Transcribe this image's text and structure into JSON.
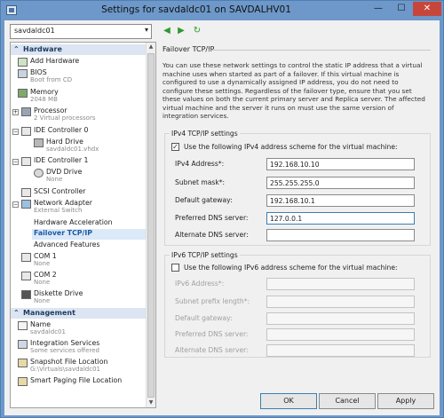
{
  "window": {
    "title": "Settings for savdaldc01 on SAVDALHV01",
    "minimize": "—",
    "maximize": "☐",
    "close": "✕"
  },
  "vm_select": {
    "value": "savdaldc01"
  },
  "nav": {
    "back": "◀",
    "forward": "▶",
    "refresh": "↻"
  },
  "sidebar": {
    "hardware_header": "Hardware",
    "management_header": "Management",
    "items": [
      {
        "label": "Add Hardware",
        "sub": ""
      },
      {
        "label": "BIOS",
        "sub": "Boot from CD"
      },
      {
        "label": "Memory",
        "sub": "2048 MB"
      },
      {
        "label": "Processor",
        "sub": "2 Virtual processors"
      },
      {
        "label": "IDE Controller 0",
        "sub": ""
      },
      {
        "label": "Hard Drive",
        "sub": "savdaldc01.vhdx"
      },
      {
        "label": "IDE Controller 1",
        "sub": ""
      },
      {
        "label": "DVD Drive",
        "sub": "None"
      },
      {
        "label": "SCSI Controller",
        "sub": ""
      },
      {
        "label": "Network Adapter",
        "sub": "External Switch"
      },
      {
        "label": "Hardware Acceleration",
        "sub": ""
      },
      {
        "label": "Failover TCP/IP",
        "sub": ""
      },
      {
        "label": "Advanced Features",
        "sub": ""
      },
      {
        "label": "COM 1",
        "sub": "None"
      },
      {
        "label": "COM 2",
        "sub": "None"
      },
      {
        "label": "Diskette Drive",
        "sub": "None"
      }
    ],
    "mgmt_items": [
      {
        "label": "Name",
        "sub": "savdaldc01"
      },
      {
        "label": "Integration Services",
        "sub": "Some services offered"
      },
      {
        "label": "Snapshot File Location",
        "sub": "G:\\Virtuals\\savdaldc01"
      },
      {
        "label": "Smart Paging File Location",
        "sub": ""
      }
    ]
  },
  "panel": {
    "title": "Failover TCP/IP",
    "description": "You can use these network settings to control the static IP address that a virtual machine uses when started as part of a failover. If this virtual machine is configured to use a dynamically assigned IP address, you do not need to configure these settings. Regardless of the failover type, ensure that you set these values on both the current primary server and Replica server. The affected virtual machine and the server it runs on must use the same version of integration services.",
    "ipv4": {
      "group_label": "IPv4 TCP/IP settings",
      "checkbox_label": "Use the following IPv4 address scheme for the virtual machine:",
      "checked": "✓",
      "ip_label": "IPv4 Address*:",
      "ip_value": "192.168.10.10",
      "mask_label": "Subnet mask*:",
      "mask_value": "255.255.255.0",
      "gw_label": "Default gateway:",
      "gw_value": "192.168.10.1",
      "dns1_label": "Preferred DNS server:",
      "dns1_value": "127.0.0.1",
      "dns2_label": "Alternate DNS server:",
      "dns2_value": ""
    },
    "ipv6": {
      "group_label": "IPv6 TCP/IP settings",
      "checkbox_label": "Use the following IPv6 address scheme for the virtual machine:",
      "ip_label": "IPv6 Address*:",
      "prefix_label": "Subnet prefix length*:",
      "gw_label": "Default gateway:",
      "dns1_label": "Preferred DNS server:",
      "dns2_label": "Alternate DNS server:"
    }
  },
  "footer": {
    "ok": "OK",
    "cancel": "Cancel",
    "apply": "Apply"
  }
}
